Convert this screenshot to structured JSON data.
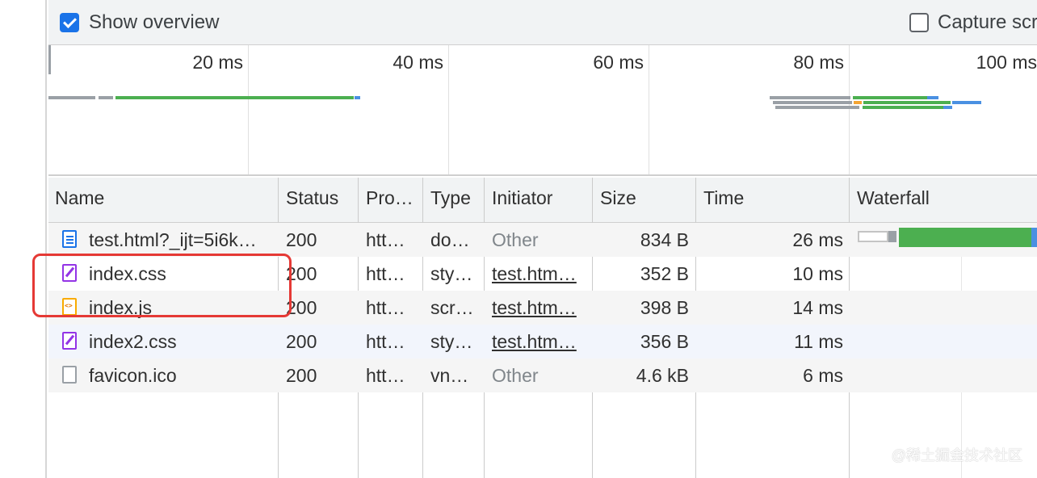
{
  "toolbar": {
    "show_overview": {
      "label": "Show overview",
      "checked": true
    },
    "capture_screenshots": {
      "label": "Capture scr",
      "checked": false
    }
  },
  "overview": {
    "ticks": [
      "20 ms",
      "40 ms",
      "60 ms",
      "80 ms",
      "100 ms"
    ]
  },
  "table": {
    "columns": {
      "name": "Name",
      "status": "Status",
      "protocol": "Pro…",
      "type": "Type",
      "initiator": "Initiator",
      "size": "Size",
      "time": "Time",
      "waterfall": "Waterfall"
    },
    "rows": [
      {
        "icon": "document-icon",
        "name": "test.html?_ijt=5i6k…",
        "status": "200",
        "protocol": "htt…",
        "type": "do…",
        "initiator": "Other",
        "initiator_link": false,
        "size": "834 B",
        "time": "26 ms"
      },
      {
        "icon": "stylesheet-icon",
        "name": "index.css",
        "status": "200",
        "protocol": "htt…",
        "type": "sty…",
        "initiator": "test.htm…",
        "initiator_link": true,
        "size": "352 B",
        "time": "10 ms"
      },
      {
        "icon": "script-icon",
        "name": "index.js",
        "status": "200",
        "protocol": "htt…",
        "type": "scr…",
        "initiator": "test.htm…",
        "initiator_link": true,
        "size": "398 B",
        "time": "14 ms"
      },
      {
        "icon": "stylesheet-icon",
        "name": "index2.css",
        "status": "200",
        "protocol": "htt…",
        "type": "sty…",
        "initiator": "test.htm…",
        "initiator_link": true,
        "size": "356 B",
        "time": "11 ms"
      },
      {
        "icon": "file-icon",
        "name": "favicon.ico",
        "status": "200",
        "protocol": "htt…",
        "type": "vn…",
        "initiator": "Other",
        "initiator_link": false,
        "size": "4.6 kB",
        "time": "6 ms"
      }
    ]
  },
  "colors": {
    "accent": "#1a73e8",
    "waiting": "#9aa0a6",
    "download_green": "#4caf50",
    "content_blue": "#4a90e2",
    "annotation_red": "#e53935"
  },
  "watermark": "@稀土掘金技术社区"
}
